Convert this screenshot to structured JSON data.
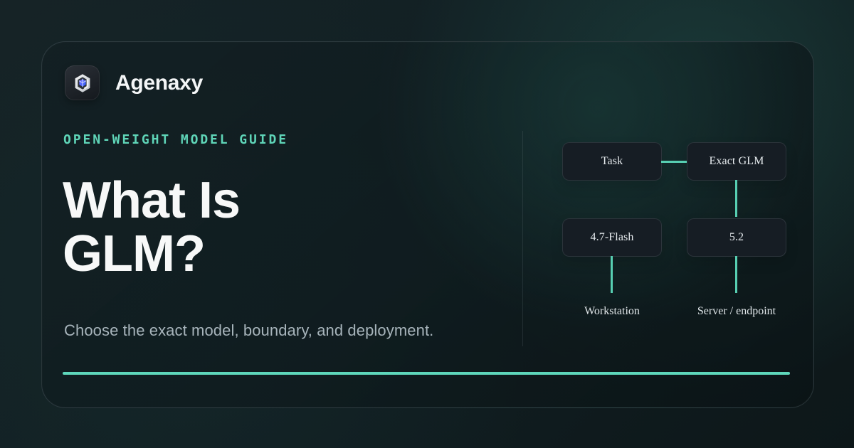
{
  "brand": {
    "name": "Agenaxy",
    "logo_icon": "cube-shield-icon"
  },
  "hero": {
    "eyebrow": "OPEN-WEIGHT MODEL GUIDE",
    "title_line_1": "What Is",
    "title_line_2": "GLM?",
    "subtitle": "Choose the exact model, boundary, and deployment."
  },
  "diagram": {
    "nodes": {
      "task": "Task",
      "exact_glm": "Exact GLM",
      "flash": "4.7-Flash",
      "five_two": "5.2"
    },
    "captions": {
      "workstation": "Workstation",
      "server_endpoint": "Server / endpoint"
    }
  },
  "colors": {
    "accent": "#5ED7BB",
    "background": "#111A1D",
    "card_background": "#131F23",
    "node_background": "#161D24",
    "heading": "#F7F8F8",
    "subtitle": "#A7B4BB"
  }
}
